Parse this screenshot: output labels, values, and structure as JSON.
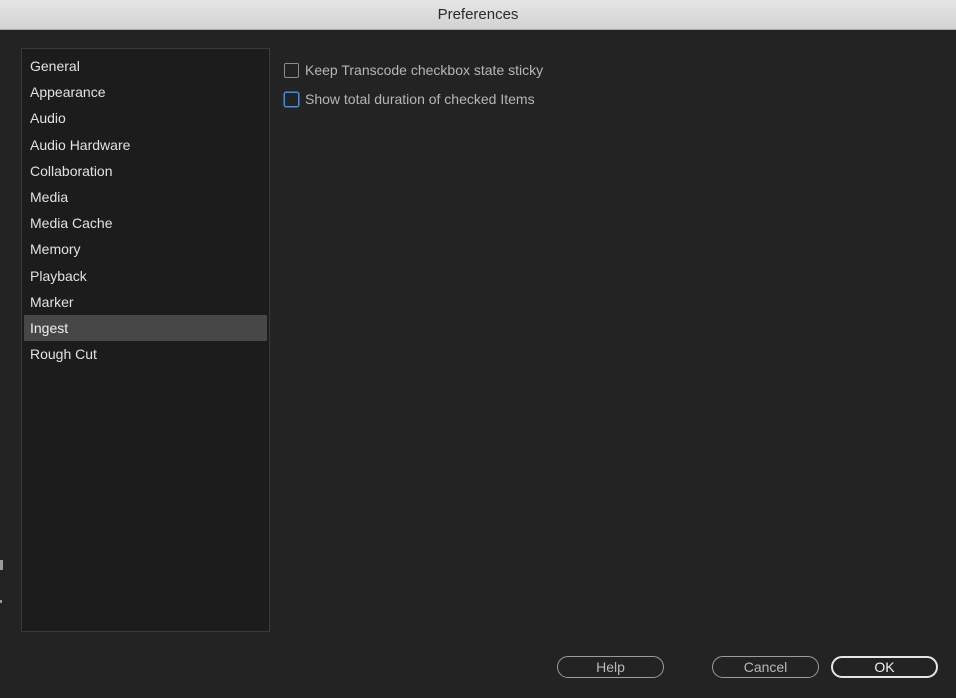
{
  "window": {
    "title": "Preferences"
  },
  "sidebar": {
    "items": [
      {
        "label": "General"
      },
      {
        "label": "Appearance"
      },
      {
        "label": "Audio"
      },
      {
        "label": "Audio Hardware"
      },
      {
        "label": "Collaboration"
      },
      {
        "label": "Media"
      },
      {
        "label": "Media Cache"
      },
      {
        "label": "Memory"
      },
      {
        "label": "Playback"
      },
      {
        "label": "Marker"
      },
      {
        "label": "Ingest"
      },
      {
        "label": "Rough Cut"
      }
    ],
    "selected": "Ingest"
  },
  "options": [
    {
      "label": "Keep Transcode checkbox state sticky",
      "checked": false
    },
    {
      "label": "Show total duration of checked Items",
      "checked": false,
      "focused": true
    }
  ],
  "buttons": {
    "help": "Help",
    "cancel": "Cancel",
    "ok": "OK"
  },
  "colors": {
    "background": "#232323",
    "sidebar_bg": "#1c1c1c",
    "selected_bg": "#474747",
    "focus_ring": "#3c8fe8",
    "titlebar": "#dcdcdc"
  }
}
